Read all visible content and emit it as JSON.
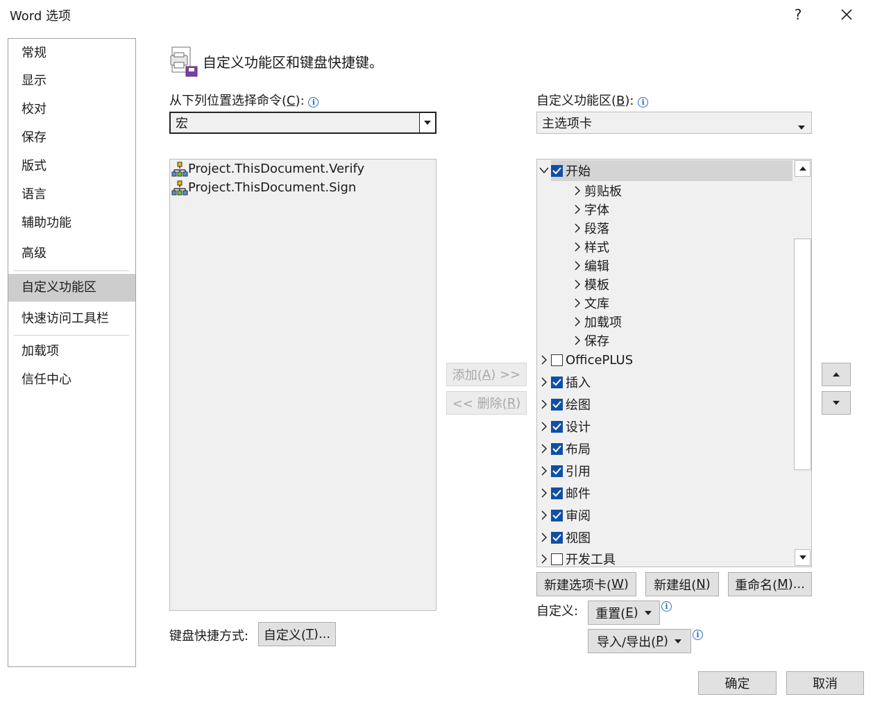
{
  "window": {
    "title": "Word 选项",
    "help_label": "?",
    "close_label": "✕"
  },
  "nav": {
    "items": [
      {
        "label": "常规"
      },
      {
        "label": "显示"
      },
      {
        "label": "校对"
      },
      {
        "label": "保存"
      },
      {
        "label": "版式"
      },
      {
        "label": "语言"
      },
      {
        "label": "辅助功能"
      },
      {
        "label": "高级"
      },
      {
        "label": "自定义功能区",
        "selected": true
      },
      {
        "label": "快速访问工具栏"
      },
      {
        "label": "加载项"
      },
      {
        "label": "信任中心"
      }
    ]
  },
  "header": {
    "title": "自定义功能区和键盘快捷键。",
    "icon": "customize-ribbon-icon"
  },
  "left": {
    "label_prefix": "从下列位置选择命令(",
    "label_key": "C",
    "label_suffix": "):",
    "combo_value": "宏",
    "items": [
      "Project.ThisDocument.Verify",
      "Project.ThisDocument.Sign"
    ],
    "item_icon": "macro-icon",
    "kb_label": "键盘快捷方式:",
    "kb_button_prefix": "自定义(",
    "kb_button_key": "T",
    "kb_button_suffix": ")..."
  },
  "middle": {
    "add_prefix": "添加(",
    "add_key": "A",
    "add_suffix": ") >>",
    "remove_prefix": "<< 删除(",
    "remove_key": "R",
    "remove_suffix": ")"
  },
  "right": {
    "label_prefix": "自定义功能区(",
    "label_key": "B",
    "label_suffix": "):",
    "combo_value": "主选项卡",
    "tree": {
      "expanded_tab": {
        "label": "开始",
        "checked": true
      },
      "groups": [
        "剪贴板",
        "字体",
        "段落",
        "样式",
        "编辑",
        "模板",
        "文库",
        "加载项",
        "保存"
      ],
      "tabs": [
        {
          "label": "OfficePLUS",
          "checked": false
        },
        {
          "label": "插入",
          "checked": true
        },
        {
          "label": "绘图",
          "checked": true
        },
        {
          "label": "设计",
          "checked": true
        },
        {
          "label": "布局",
          "checked": true
        },
        {
          "label": "引用",
          "checked": true
        },
        {
          "label": "邮件",
          "checked": true
        },
        {
          "label": "审阅",
          "checked": true
        },
        {
          "label": "视图",
          "checked": true
        },
        {
          "label": "开发工具",
          "checked": false
        }
      ]
    },
    "new_tab_prefix": "新建选项卡(",
    "new_tab_key": "W",
    "new_tab_suffix": ")",
    "new_group_prefix": "新建组(",
    "new_group_key": "N",
    "new_group_suffix": ")",
    "rename_prefix": "重命名(",
    "rename_key": "M",
    "rename_suffix": ")...",
    "customize_label": "自定义:",
    "reset_prefix": "重置(",
    "reset_key": "E",
    "reset_suffix": ")",
    "import_prefix": "导入/导出(",
    "import_key": "P",
    "import_suffix": ")"
  },
  "footer": {
    "ok_label": "确定",
    "cancel_label": "取消"
  },
  "colors": {
    "accent": "#0f4fa8",
    "selected_bg": "#cdcdcd",
    "info": "#2b6cc4"
  }
}
